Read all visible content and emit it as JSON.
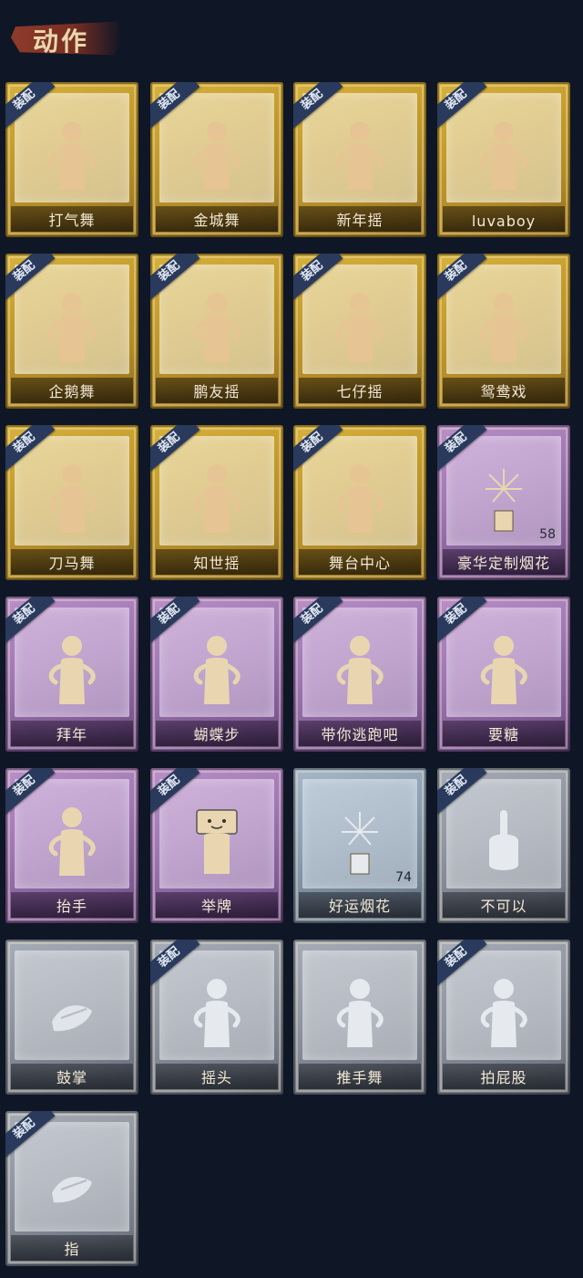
{
  "header": {
    "title": "动作"
  },
  "colors": {
    "background": "#0f1626",
    "gold": "#c59d2e",
    "purple": "#9f78b4",
    "silver": "#8f96a1",
    "bluegray": "#8d9fb2",
    "badge": "#2a3a5c"
  },
  "badge_label": "装配",
  "cards": [
    {
      "label": "打气舞",
      "tier": "gold",
      "equipped": true,
      "icon": "dance-figure-icon"
    },
    {
      "label": "金城舞",
      "tier": "gold",
      "equipped": true,
      "icon": "dance-figure-icon"
    },
    {
      "label": "新年摇",
      "tier": "gold",
      "equipped": true,
      "icon": "dance-figure-icon"
    },
    {
      "label": "luvaboy",
      "tier": "gold",
      "equipped": true,
      "icon": "dance-figure-icon"
    },
    {
      "label": "企鹅舞",
      "tier": "gold",
      "equipped": true,
      "icon": "dance-figure-icon"
    },
    {
      "label": "鹏友摇",
      "tier": "gold",
      "equipped": true,
      "icon": "dance-figure-icon"
    },
    {
      "label": "七仔摇",
      "tier": "gold",
      "equipped": true,
      "icon": "dance-figure-icon"
    },
    {
      "label": "鸳鸯戏",
      "tier": "gold",
      "equipped": true,
      "icon": "dance-figure-icon"
    },
    {
      "label": "刀马舞",
      "tier": "gold",
      "equipped": true,
      "icon": "dance-figure-icon"
    },
    {
      "label": "知世摇",
      "tier": "gold",
      "equipped": true,
      "icon": "dance-figure-icon"
    },
    {
      "label": "舞台中心",
      "tier": "gold",
      "equipped": true,
      "icon": "dance-figure-icon"
    },
    {
      "label": "豪华定制烟花",
      "tier": "purple",
      "equipped": true,
      "icon": "fireworks-icon",
      "count": "58"
    },
    {
      "label": "拜年",
      "tier": "purple",
      "equipped": true,
      "icon": "figure-icon"
    },
    {
      "label": "蝴蝶步",
      "tier": "purple",
      "equipped": true,
      "icon": "figure-icon"
    },
    {
      "label": "带你逃跑吧",
      "tier": "purple",
      "equipped": true,
      "icon": "figure-icon"
    },
    {
      "label": "要糖",
      "tier": "purple",
      "equipped": true,
      "icon": "figure-icon"
    },
    {
      "label": "抬手",
      "tier": "purple",
      "equipped": true,
      "icon": "figure-icon"
    },
    {
      "label": "举牌",
      "tier": "purple",
      "equipped": true,
      "icon": "sign-holder-icon"
    },
    {
      "label": "好运烟花",
      "tier": "bluegray",
      "equipped": false,
      "icon": "firework-can-icon",
      "count": "74"
    },
    {
      "label": "不可以",
      "tier": "silver",
      "equipped": true,
      "icon": "finger-wag-icon"
    },
    {
      "label": "鼓掌",
      "tier": "silver",
      "equipped": false,
      "icon": "clap-hands-icon"
    },
    {
      "label": "摇头",
      "tier": "silver",
      "equipped": true,
      "icon": "figure-icon"
    },
    {
      "label": "推手舞",
      "tier": "silver",
      "equipped": false,
      "icon": "figure-icon"
    },
    {
      "label": "拍屁股",
      "tier": "silver",
      "equipped": true,
      "icon": "figure-icon"
    },
    {
      "label": "指",
      "tier": "silver",
      "equipped": true,
      "icon": "pointing-hand-icon"
    }
  ]
}
